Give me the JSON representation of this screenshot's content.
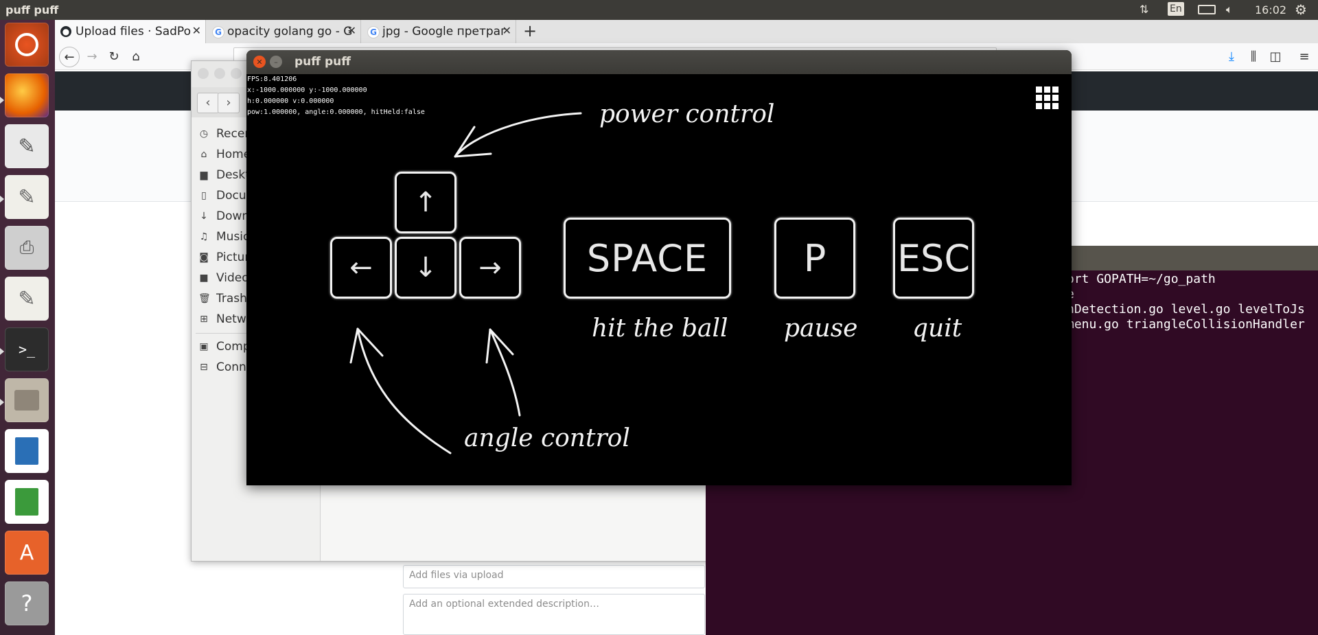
{
  "top_panel": {
    "title": "puff puff",
    "keyboard_layout": "En",
    "clock": "16:02"
  },
  "launcher": {
    "items": [
      "ubuntu-icon",
      "firefox-icon",
      "text-editor-icon",
      "notes-icon",
      "scanner-icon",
      "writer-icon",
      "terminal-icon",
      "files-icon",
      "impress-icon",
      "calc-icon",
      "software-center-icon",
      "help-icon"
    ]
  },
  "browser": {
    "tabs": [
      {
        "label": "Upload files · SadPo",
        "icon": "github-icon"
      },
      {
        "label": "opacity golang go - G",
        "icon": "google-icon"
      },
      {
        "label": "jpg - Google претраг",
        "icon": "google-icon"
      }
    ],
    "new_tab_symbol": "+",
    "upload_placeholder": "Add files via upload",
    "description_placeholder": "Add an optional extended description…"
  },
  "files": {
    "sidebar": [
      "Recent",
      "Home",
      "Desktop",
      "Documents",
      "Downloads",
      "Music",
      "Pictures",
      "Videos",
      "Trash",
      "Network"
    ],
    "sidebar_visible": [
      "Recen",
      "Home",
      "Deskt",
      "Docu",
      "Down",
      "Music",
      "Pictur",
      "Video",
      "Trash",
      "Netw"
    ],
    "devices_visible": [
      "Comp",
      "Conn"
    ]
  },
  "terminal": {
    "lines": [
      "ort GOPATH=~/go_path",
      "e",
      "nDetection.go level.go levelToJs",
      "menu.go triangleCollisionHandler"
    ]
  },
  "game": {
    "title": "puff puff",
    "debug": [
      "FPS:8.401206",
      "x:-1000.000000 y:-1000.000000",
      "h:0.000000 v:0.000000",
      "pow:1.000000, angle:0.000000, hitHeld:false"
    ],
    "keys": {
      "up": "↑",
      "left": "←",
      "down": "↓",
      "right": "→",
      "space": "SPACE",
      "pause": "P",
      "esc": "ESC"
    },
    "labels": {
      "power_control": "power control",
      "angle_control": "angle control",
      "hit_the_ball": "hit the ball",
      "pause": "pause",
      "quit": "quit"
    }
  }
}
